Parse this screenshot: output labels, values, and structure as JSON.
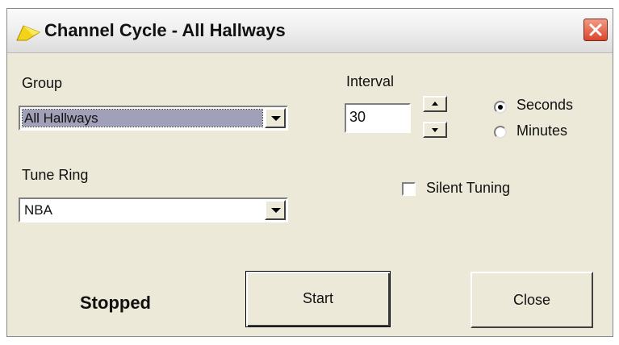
{
  "window": {
    "title": "Channel Cycle - All Hallways"
  },
  "group": {
    "label": "Group",
    "value": "All Hallways"
  },
  "tune_ring": {
    "label": "Tune Ring",
    "value": "NBA"
  },
  "interval": {
    "label": "Interval",
    "value": "30",
    "unit_options": [
      {
        "label": "Seconds",
        "selected": true
      },
      {
        "label": "Minutes",
        "selected": false
      }
    ]
  },
  "silent_tuning": {
    "label": "Silent Tuning",
    "checked": false
  },
  "status": "Stopped",
  "buttons": {
    "start": "Start",
    "close": "Close"
  },
  "icons": {
    "app": "yellow-tv-arrow-icon",
    "close": "close-icon",
    "dropdown": "chevron-down-icon",
    "spin_up": "arrow-up-icon",
    "spin_down": "arrow-down-icon"
  },
  "colors": {
    "close_button": "#d9452b",
    "dialog_bg": "#ece9d8",
    "selection": "#a0a0b8"
  }
}
